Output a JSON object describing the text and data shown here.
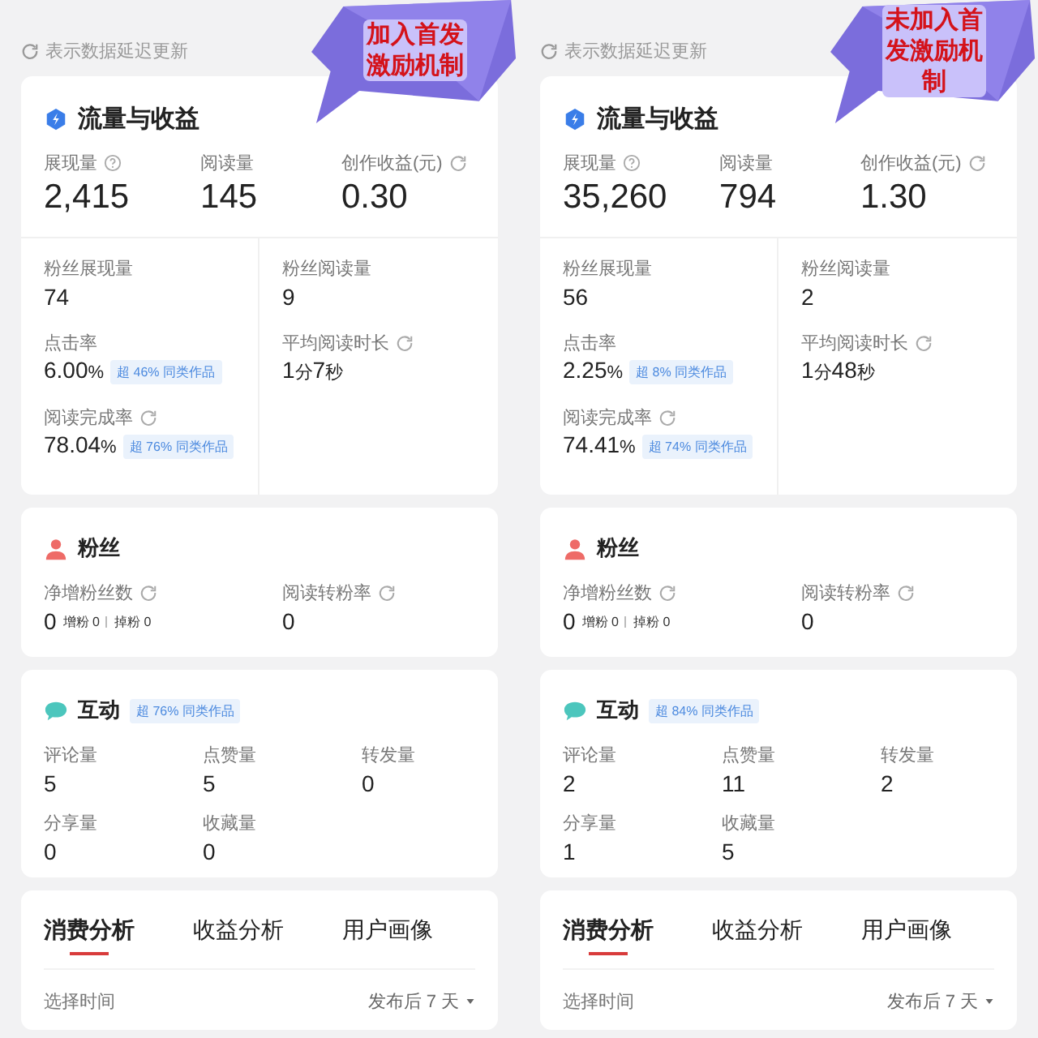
{
  "panels": [
    {
      "annotation": "加入首发激励机制",
      "delay_note": "表示数据延迟更新",
      "traffic": {
        "title": "流量与收益",
        "top": [
          {
            "label": "展现量",
            "help_icon": true,
            "value": "2,415"
          },
          {
            "label": "阅读量",
            "value": "145"
          },
          {
            "label": "创作收益(元)",
            "refresh_icon": true,
            "value": "0.30"
          }
        ],
        "left": [
          {
            "label": "粉丝展现量",
            "parts": [
              {
                "kind": "num",
                "text": "74"
              }
            ]
          },
          {
            "label": "点击率",
            "parts": [
              {
                "kind": "num",
                "text": "6.00"
              },
              {
                "kind": "unit",
                "text": "%"
              }
            ],
            "badge": "超 46% 同类作品"
          },
          {
            "label": "阅读完成率",
            "refresh_icon": true,
            "parts": [
              {
                "kind": "num",
                "text": "78.04"
              },
              {
                "kind": "unit",
                "text": "%"
              }
            ],
            "badge": "超 76% 同类作品"
          }
        ],
        "right": [
          {
            "label": "粉丝阅读量",
            "parts": [
              {
                "kind": "num",
                "text": "9"
              }
            ]
          },
          {
            "label": "平均阅读时长",
            "refresh_icon": true,
            "parts": [
              {
                "kind": "num",
                "text": "1"
              },
              {
                "kind": "unit",
                "text": "分"
              },
              {
                "kind": "num",
                "text": "7"
              },
              {
                "kind": "unit",
                "text": "秒"
              }
            ]
          }
        ]
      },
      "fans": {
        "title": "粉丝",
        "metrics": [
          {
            "label": "净增粉丝数",
            "refresh_icon": true,
            "value": "0",
            "subs": [
              "增粉 0",
              "掉粉 0"
            ]
          },
          {
            "label": "阅读转粉率",
            "refresh_icon": true,
            "value": "0"
          }
        ]
      },
      "interaction": {
        "title": "互动",
        "badge": "超 76% 同类作品",
        "metrics": [
          {
            "label": "评论量",
            "value": "5"
          },
          {
            "label": "点赞量",
            "value": "5"
          },
          {
            "label": "转发量",
            "value": "0"
          },
          {
            "label": "分享量",
            "value": "0"
          },
          {
            "label": "收藏量",
            "value": "0"
          }
        ]
      },
      "tabs": [
        {
          "label": "消费分析",
          "selected": true
        },
        {
          "label": "收益分析",
          "selected": false
        },
        {
          "label": "用户画像",
          "selected": false
        }
      ],
      "time_filter": {
        "label": "选择时间",
        "value": "发布后 7 天"
      }
    },
    {
      "annotation": "未加入首发激励机制",
      "delay_note": "表示数据延迟更新",
      "traffic": {
        "title": "流量与收益",
        "top": [
          {
            "label": "展现量",
            "help_icon": true,
            "value": "35,260"
          },
          {
            "label": "阅读量",
            "value": "794"
          },
          {
            "label": "创作收益(元)",
            "refresh_icon": true,
            "value": "1.30"
          }
        ],
        "left": [
          {
            "label": "粉丝展现量",
            "parts": [
              {
                "kind": "num",
                "text": "56"
              }
            ]
          },
          {
            "label": "点击率",
            "parts": [
              {
                "kind": "num",
                "text": "2.25"
              },
              {
                "kind": "unit",
                "text": "%"
              }
            ],
            "badge": "超 8% 同类作品"
          },
          {
            "label": "阅读完成率",
            "refresh_icon": true,
            "parts": [
              {
                "kind": "num",
                "text": "74.41"
              },
              {
                "kind": "unit",
                "text": "%"
              }
            ],
            "badge": "超 74% 同类作品"
          }
        ],
        "right": [
          {
            "label": "粉丝阅读量",
            "parts": [
              {
                "kind": "num",
                "text": "2"
              }
            ]
          },
          {
            "label": "平均阅读时长",
            "refresh_icon": true,
            "parts": [
              {
                "kind": "num",
                "text": "1"
              },
              {
                "kind": "unit",
                "text": "分"
              },
              {
                "kind": "num",
                "text": "48"
              },
              {
                "kind": "unit",
                "text": "秒"
              }
            ]
          }
        ]
      },
      "fans": {
        "title": "粉丝",
        "metrics": [
          {
            "label": "净增粉丝数",
            "refresh_icon": true,
            "value": "0",
            "subs": [
              "增粉 0",
              "掉粉 0"
            ]
          },
          {
            "label": "阅读转粉率",
            "refresh_icon": true,
            "value": "0"
          }
        ]
      },
      "interaction": {
        "title": "互动",
        "badge": "超 84% 同类作品",
        "metrics": [
          {
            "label": "评论量",
            "value": "2"
          },
          {
            "label": "点赞量",
            "value": "11"
          },
          {
            "label": "转发量",
            "value": "2"
          },
          {
            "label": "分享量",
            "value": "1"
          },
          {
            "label": "收藏量",
            "value": "5"
          }
        ]
      },
      "tabs": [
        {
          "label": "消费分析",
          "selected": true
        },
        {
          "label": "收益分析",
          "selected": false
        },
        {
          "label": "用户画像",
          "selected": false
        }
      ],
      "time_filter": {
        "label": "选择时间",
        "value": "发布后 7 天"
      }
    }
  ]
}
